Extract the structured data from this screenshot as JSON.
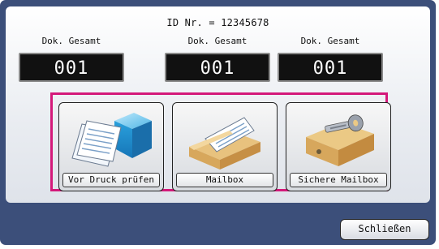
{
  "header": {
    "id_text": "ID Nr. = 12345678"
  },
  "counters": [
    {
      "label": "Dok. Gesamt",
      "value": "001"
    },
    {
      "label": "Dok. Gesamt",
      "value": "001"
    },
    {
      "label": "Dok. Gesamt",
      "value": "001"
    }
  ],
  "modes": [
    {
      "label": "Vor Druck prüfen",
      "icon": "preview-documents-icon"
    },
    {
      "label": "Mailbox",
      "icon": "mailbox-tray-icon"
    },
    {
      "label": "Sichere Mailbox",
      "icon": "secure-mailbox-key-icon"
    }
  ],
  "footer": {
    "close_label": "Schließen"
  },
  "colors": {
    "background": "#3c4f7a",
    "highlight": "#d4197a",
    "counter_bg": "#111111"
  }
}
